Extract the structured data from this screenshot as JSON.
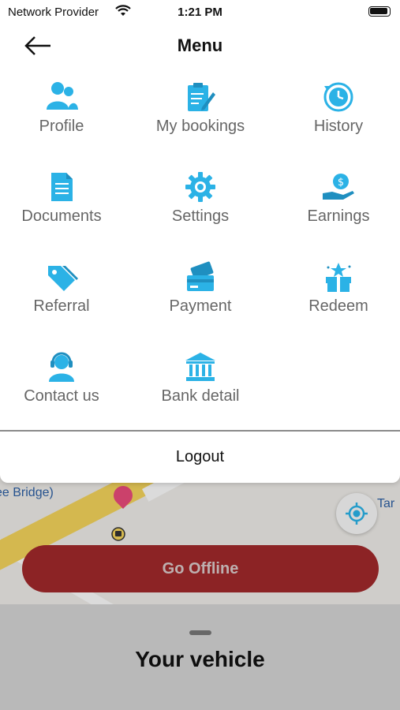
{
  "status_bar": {
    "carrier": "Network Provider",
    "time": "1:21 PM"
  },
  "header": {
    "title": "Menu"
  },
  "menu_items": [
    {
      "label": "Profile",
      "icon": "people-icon"
    },
    {
      "label": "My bookings",
      "icon": "clipboard-icon"
    },
    {
      "label": "History",
      "icon": "history-clock-icon"
    },
    {
      "label": "Documents",
      "icon": "document-icon"
    },
    {
      "label": "Settings",
      "icon": "gear-icon"
    },
    {
      "label": "Earnings",
      "icon": "money-hand-icon"
    },
    {
      "label": "Referral",
      "icon": "tag-icon"
    },
    {
      "label": "Payment",
      "icon": "card-icon"
    },
    {
      "label": "Redeem",
      "icon": "gift-icon"
    },
    {
      "label": "Contact us",
      "icon": "support-agent-icon"
    },
    {
      "label": "Bank detail",
      "icon": "bank-icon"
    }
  ],
  "logout_label": "Logout",
  "map": {
    "place_label_left": "ee Bridge)",
    "place_label_right": "Tar"
  },
  "go_offline_label": "Go Offline",
  "sheet": {
    "title": "Your vehicle"
  },
  "colors": {
    "accent": "#2bb2e6",
    "offline_button": "#a0282b"
  }
}
